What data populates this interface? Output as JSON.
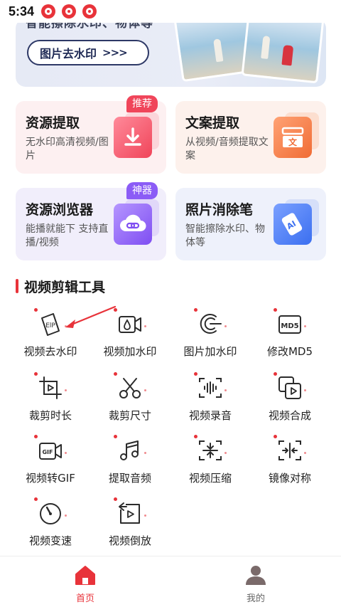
{
  "status_bar": {
    "time": "5:34"
  },
  "banner": {
    "partial_text": "智能擦除水印、物体等",
    "button_label": "图片去水印",
    "button_arrows": ">>>"
  },
  "cards": [
    {
      "title": "资源提取",
      "desc": "无水印高清视频/图片",
      "badge": "推荐",
      "icon": "download-icon",
      "accent": "#f0455a"
    },
    {
      "title": "文案提取",
      "desc": "从视频/音频提取文案",
      "badge": "",
      "icon": "text-document-icon",
      "accent": "#f47a3d"
    },
    {
      "title": "资源浏览器",
      "desc": "能播就能下 支持直播/视频",
      "badge": "神器",
      "icon": "cloud-link-icon",
      "accent": "#8b5cf6"
    },
    {
      "title": "照片消除笔",
      "desc": "智能擦除水印、物体等",
      "badge": "",
      "icon": "ai-eraser-icon",
      "accent": "#3b6ff0"
    }
  ],
  "section": {
    "title": "视频剪辑工具"
  },
  "tools": [
    {
      "label": "视频去水印",
      "icon": "video-remove-watermark-icon"
    },
    {
      "label": "视频加水印",
      "icon": "video-add-watermark-icon"
    },
    {
      "label": "图片加水印",
      "icon": "image-add-watermark-icon"
    },
    {
      "label": "修改MD5",
      "icon": "md5-icon"
    },
    {
      "label": "裁剪时长",
      "icon": "trim-duration-icon"
    },
    {
      "label": "裁剪尺寸",
      "icon": "crop-size-icon"
    },
    {
      "label": "视频录音",
      "icon": "audio-record-icon"
    },
    {
      "label": "视频合成",
      "icon": "video-merge-icon"
    },
    {
      "label": "视频转GIF",
      "icon": "video-to-gif-icon"
    },
    {
      "label": "提取音频",
      "icon": "extract-audio-icon"
    },
    {
      "label": "视频压缩",
      "icon": "video-compress-icon"
    },
    {
      "label": "镜像对称",
      "icon": "mirror-icon"
    },
    {
      "label": "视频变速",
      "icon": "speed-icon"
    },
    {
      "label": "视频倒放",
      "icon": "reverse-icon"
    }
  ],
  "icon_text": {
    "md5": "MD5",
    "gif": "GIF",
    "ai": "AI",
    "wen": "文",
    "elip": "ElP"
  },
  "bottom_nav": [
    {
      "label": "首页",
      "icon": "home-icon",
      "active": true
    },
    {
      "label": "我的",
      "icon": "profile-icon",
      "active": false
    }
  ],
  "colors": {
    "accent": "#e8333a",
    "icon_stroke": "#2b2b2b"
  }
}
